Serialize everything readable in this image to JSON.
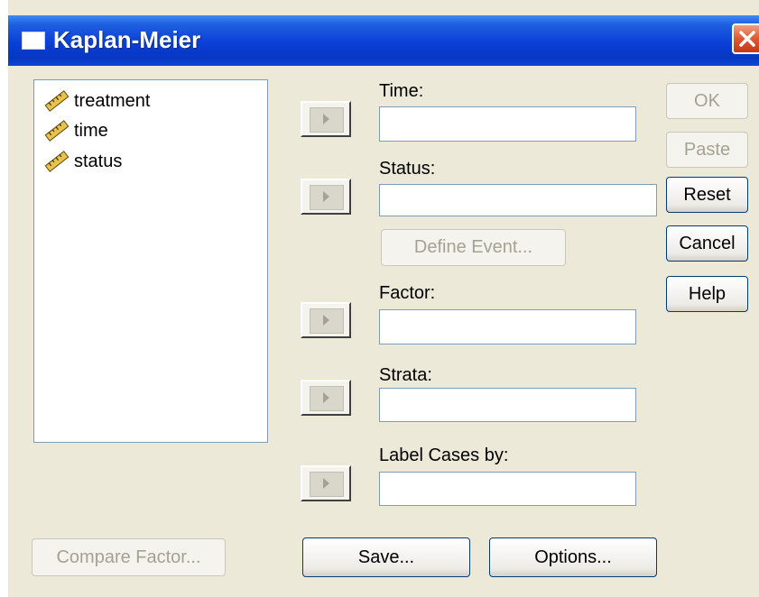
{
  "window": {
    "title": "Kaplan-Meier"
  },
  "variables": [
    {
      "label": "treatment",
      "icon": "scale-variable-icon"
    },
    {
      "label": "time",
      "icon": "scale-variable-icon"
    },
    {
      "label": "status",
      "icon": "scale-variable-icon"
    }
  ],
  "fields": {
    "time_label": "Time:",
    "time_value": "",
    "status_label": "Status:",
    "status_value": "",
    "factor_label": "Factor:",
    "factor_value": "",
    "strata_label": "Strata:",
    "strata_value": "",
    "label_cases_label": "Label Cases by:",
    "label_cases_value": ""
  },
  "buttons": {
    "define_event": "Define Event...",
    "ok": "OK",
    "paste": "Paste",
    "reset": "Reset",
    "cancel": "Cancel",
    "help": "Help",
    "compare_factor": "Compare Factor...",
    "save": "Save...",
    "options": "Options..."
  },
  "states": {
    "ok_enabled": false,
    "paste_enabled": false,
    "define_event_enabled": false,
    "compare_factor_enabled": false
  },
  "colors": {
    "title_bar": "#0a3fd6",
    "dialog_bg": "#ece9d8",
    "button_border": "#003c74",
    "close_button": "#e0582f",
    "disabled_text": "#a5a293"
  }
}
